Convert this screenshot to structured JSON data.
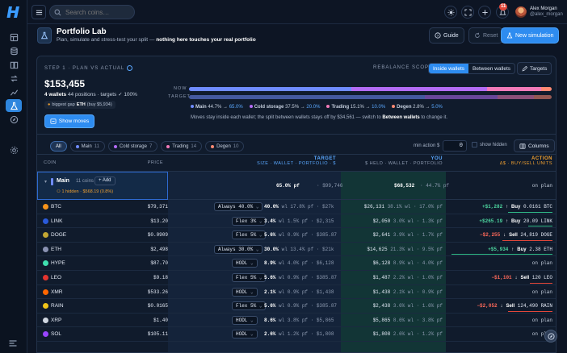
{
  "topbar": {
    "search_placeholder": "Search coins…",
    "notification_count": "11",
    "user_name": "Alex Morgan",
    "user_handle": "@alex_morgan"
  },
  "header": {
    "title": "Portfolio Lab",
    "subtitle_pre": "Plan, simulate and stress-test your split — ",
    "subtitle_bold": "nothing here touches your real portfolio",
    "guide_label": "Guide",
    "reset_label": "Reset",
    "new_sim_label": "New simulation"
  },
  "plan": {
    "step_label": "STEP 1 · PLAN VS ACTUAL",
    "total": "$153,455",
    "wallets_bold": "4 wallets",
    "positions_text": "44 positions · targets ✓ 100%",
    "gap_pre": "biggest gap",
    "gap_coin": "ETH",
    "gap_post": "(buy $5,934)",
    "show_moves_label": "Show moves",
    "rebalance_label": "REBALANCE SCOPE",
    "scope_inside": "Inside wallets",
    "scope_between": "Between wallets",
    "targets_label": "Targets",
    "now_label": "NOW",
    "target_label": "TARGET",
    "now_split": [
      44.7,
      37.5,
      15.1,
      2.8
    ],
    "target_split": [
      65.0,
      20.0,
      10.0,
      5.0
    ],
    "legend": [
      {
        "name": "Main",
        "now": "44.7%",
        "target": "65.0%",
        "color": "#6f8cff"
      },
      {
        "name": "Cold storage",
        "now": "37.5%",
        "target": "20.0%",
        "color": "#b36cf5"
      },
      {
        "name": "Trading",
        "now": "15.1%",
        "target": "10.0%",
        "color": "#f27ab8"
      },
      {
        "name": "Degen",
        "now": "2.8%",
        "target": "5.0%",
        "color": "#ff8a73"
      }
    ],
    "note_pre": "Moves stay inside each wallet; the split between wallets stays off by $34,561 — switch to ",
    "note_bold": "Between wallets",
    "note_post": " to change it."
  },
  "filters": {
    "chips": [
      {
        "label": "All",
        "count": ""
      },
      {
        "label": "Main",
        "count": "11"
      },
      {
        "label": "Cold storage",
        "count": "7"
      },
      {
        "label": "Trading",
        "count": "14"
      },
      {
        "label": "Degen",
        "count": "10"
      }
    ],
    "min_action_label": "min action $",
    "min_action_value": "0",
    "show_hidden_label": "show hidden",
    "columns_label": "Columns"
  },
  "columns": {
    "coin": "COIN",
    "price": "PRICE",
    "target": "TARGET",
    "target_sub": "SIZE · WALLET · PORTFOLIO · $",
    "you": "YOU",
    "you_sub": "$ HELD · WALLET · PORTFOLIO",
    "action": "ACTION",
    "action_sub": "Δ$ · BUY/SELL UNITS"
  },
  "group": {
    "name": "Main",
    "count": "11 coins",
    "add_label": "Add",
    "hidden_note": "1 hidden · $568.19 (0.8%)",
    "target_pct": "65.0% pf",
    "target_usd": "· $99,746",
    "you_usd": "$68,532",
    "you_pct": "· 44.7% pf",
    "action": "on plan"
  },
  "rows": [
    {
      "coin": "BTC",
      "color": "#f7931a",
      "price": "$79,371",
      "policy": "Always 40.0%",
      "t1": "40.0%",
      "t2": "wl 17.8% pf · $27k",
      "y1": "$26,131",
      "y2": "38.1% wl · 17.0% pf",
      "d": "+$1,282",
      "dir": "Buy",
      "qty": "0.0161 BTC",
      "kind": "pos",
      "lw": 55
    },
    {
      "coin": "LINK",
      "color": "#2a5ada",
      "price": "$13.20",
      "policy": "Flex 3%",
      "t1": "3.4%",
      "t2": "wl 1.5% pf · $2,315",
      "y1": "$2,050",
      "y2": "3.0% wl · 1.3% pf",
      "d": "+$265.19",
      "dir": "Buy",
      "qty": "20.09 LINK",
      "kind": "pos",
      "lw": 30
    },
    {
      "coin": "DOGE",
      "color": "#c2a633",
      "price": "$0.0909",
      "policy": "Flex 5%",
      "t1": "5.6%",
      "t2": "wl 0.9% pf · $385.87",
      "y1": "$2,641",
      "y2": "3.9% wl · 1.7% pf",
      "d": "−$2,255",
      "dir": "Sell",
      "qty": "24,819 DOGE",
      "kind": "neg",
      "lw": 62
    },
    {
      "coin": "ETH",
      "color": "#8a92b2",
      "price": "$2,498",
      "policy": "Always 30.0%",
      "t1": "30.0%",
      "t2": "wl 13.4% pf · $21k",
      "y1": "$14,625",
      "y2": "21.3% wl · 9.5% pf",
      "d": "+$5,934",
      "dir": "Buy",
      "qty": "2.38 ETH",
      "kind": "pos",
      "lw": 125
    },
    {
      "coin": "HYPE",
      "color": "#3fe0b0",
      "price": "$87.70",
      "policy": "HODL",
      "t1": "8.9%",
      "t2": "wl 4.0% pf · $6,128",
      "y1": "$6,128",
      "y2": "8.9% wl · 4.0% pf",
      "d": "",
      "dir": "",
      "qty": "on plan",
      "kind": "plan",
      "lw": 0
    },
    {
      "coin": "LEO",
      "color": "#e3342f",
      "price": "$9.18",
      "policy": "Flex 5%",
      "t1": "5.6%",
      "t2": "wl 0.9% pf · $385.87",
      "y1": "$1,487",
      "y2": "2.2% wl · 1.0% pf",
      "d": "−$1,101",
      "dir": "Sell",
      "qty": "120 LEO",
      "kind": "neg",
      "lw": 28
    },
    {
      "coin": "XMR",
      "color": "#ff6600",
      "price": "$533.26",
      "policy": "HODL",
      "t1": "2.1%",
      "t2": "wl 0.9% pf · $1,438",
      "y1": "$1,438",
      "y2": "2.1% wl · 0.9% pf",
      "d": "",
      "dir": "",
      "qty": "on plan",
      "kind": "plan",
      "lw": 0
    },
    {
      "coin": "RAIN",
      "color": "#f0c419",
      "price": "$0.0165",
      "policy": "Flex 5%",
      "t1": "5.6%",
      "t2": "wl 0.9% pf · $385.87",
      "y1": "$2,438",
      "y2": "3.6% wl · 1.6% pf",
      "d": "−$2,052",
      "dir": "Sell",
      "qty": "124,490 RAIN",
      "kind": "neg",
      "lw": 55
    },
    {
      "coin": "XRP",
      "color": "#cfd6e0",
      "price": "$1.40",
      "policy": "HODL",
      "t1": "8.6%",
      "t2": "wl 3.8% pf · $5,865",
      "y1": "$5,865",
      "y2": "8.6% wl · 3.8% pf",
      "d": "",
      "dir": "",
      "qty": "on plan",
      "kind": "plan",
      "lw": 0
    },
    {
      "coin": "SOL",
      "color": "#9945ff",
      "price": "$105.11",
      "policy": "HODL",
      "t1": "2.6%",
      "t2": "wl 1.2% pf · $1,808",
      "y1": "$1,808",
      "y2": "2.6% wl · 1.2% pf",
      "d": "",
      "dir": "",
      "qty": "on plan",
      "kind": "plan",
      "lw": 0
    }
  ]
}
